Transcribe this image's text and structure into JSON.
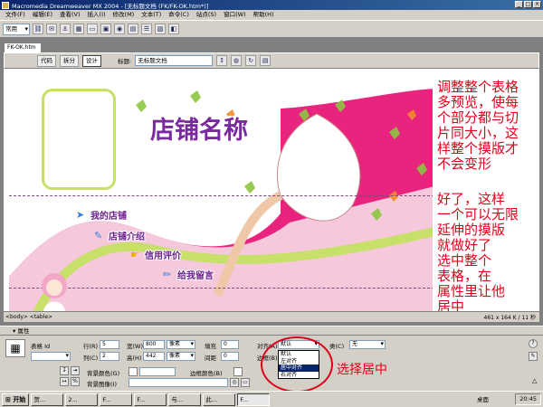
{
  "window": {
    "title": "Macromedia Dreamweaver MX 2004 - [无标题文档 (FK/FK-OK.htm*)]"
  },
  "menu": [
    "文件(F)",
    "编辑(E)",
    "查看(V)",
    "插入(I)",
    "修改(M)",
    "文本(T)",
    "命令(C)",
    "站点(S)",
    "窗口(W)",
    "帮助(H)"
  ],
  "insert_toolbar": {
    "category": "常用"
  },
  "document": {
    "tab": "FK-OK.htm",
    "views": {
      "code": "代码",
      "split": "拆分",
      "design": "设计"
    },
    "title_label": "标题:",
    "title_value": "无标题文档"
  },
  "design": {
    "shop_name": "店铺名称",
    "nav": [
      "我的店铺",
      "店铺介绍",
      "信用评价",
      "给我留言"
    ]
  },
  "annotations": {
    "first": [
      "调整整个表格",
      "多预览，使每",
      "个部分都与切",
      "片同大小，这",
      "样整个摸版才",
      "不会变形"
    ],
    "second": [
      "好了，这样",
      "一个可以无限",
      "延伸的摸版",
      "就做好了",
      "选中整个",
      "表格，在",
      "属性里让他",
      "居中"
    ],
    "center_label": "选择居中"
  },
  "statusbar": {
    "tags": "<body> <table>",
    "info": "461 x 164 K / 11 秒"
  },
  "properties": {
    "header": "属性",
    "table_label": "表格 Id",
    "rows_label": "行(R)",
    "rows": "5",
    "cols_label": "列(C)",
    "cols": "2",
    "width_label": "宽(W)",
    "width": "800",
    "width_unit": "像素",
    "height_label": "高(H)",
    "height": "442",
    "height_unit": "像素",
    "padding_label": "填充",
    "padding": "0",
    "spacing_label": "间距",
    "spacing": "0",
    "align_label": "对齐(A)",
    "align_value": "默认",
    "border_label": "边框(B)",
    "border": "0",
    "class_label": "类(C)",
    "class_value": "无",
    "bgcolor_label": "背景颜色(G)",
    "bordercolor_label": "边框颜色(B)",
    "bgimage_label": "背景图像(I)",
    "align_options": [
      "默认",
      "左对齐",
      "居中对齐",
      "右对齐"
    ],
    "align_selected_index": 2
  },
  "taskbar": {
    "start": "开始",
    "items": [
      "贺...",
      "2...",
      "F...",
      "F...",
      "与...",
      "此...",
      "F..."
    ],
    "desktop": "桌面",
    "clock": "20:45"
  }
}
